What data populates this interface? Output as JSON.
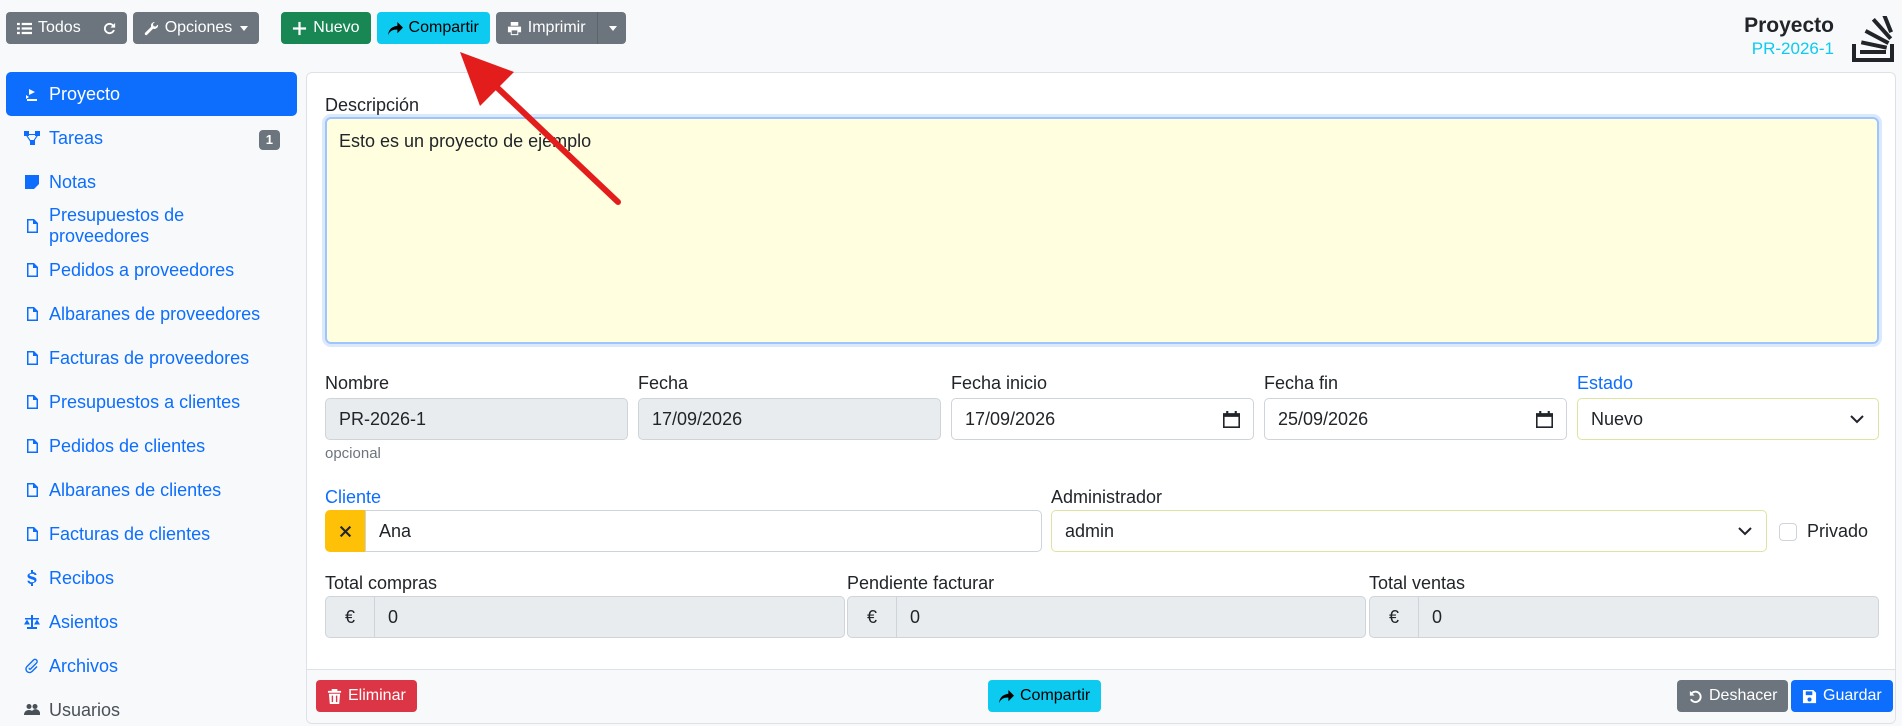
{
  "toolbar": {
    "all_label": "Todos",
    "options_label": "Opciones",
    "new_label": "Nuevo",
    "share_label": "Compartir",
    "print_label": "Imprimir"
  },
  "header": {
    "title": "Proyecto",
    "code": "PR-2026-1"
  },
  "sidebar": {
    "items": [
      {
        "label": "Proyecto",
        "icon": "project-icon"
      },
      {
        "label": "Tareas",
        "icon": "tasks-icon",
        "badge": "1"
      },
      {
        "label": "Notas",
        "icon": "note-icon"
      },
      {
        "label": "Presupuestos de proveedores",
        "icon": "file-icon"
      },
      {
        "label": "Pedidos a proveedores",
        "icon": "file-icon"
      },
      {
        "label": "Albaranes de proveedores",
        "icon": "file-icon"
      },
      {
        "label": "Facturas de proveedores",
        "icon": "file-icon"
      },
      {
        "label": "Presupuestos a clientes",
        "icon": "file-icon"
      },
      {
        "label": "Pedidos de clientes",
        "icon": "file-icon"
      },
      {
        "label": "Albaranes de clientes",
        "icon": "file-icon"
      },
      {
        "label": "Facturas de clientes",
        "icon": "file-icon"
      },
      {
        "label": "Recibos",
        "icon": "dollar-icon"
      },
      {
        "label": "Asientos",
        "icon": "balance-icon"
      },
      {
        "label": "Archivos",
        "icon": "paperclip-icon"
      },
      {
        "label": "Usuarios",
        "icon": "users-icon"
      }
    ]
  },
  "form": {
    "description_label": "Descripción",
    "description_value": "Esto es un proyecto de ejemplo",
    "name_label": "Nombre",
    "name_value": "PR-2026-1",
    "name_help": "opcional",
    "date_label": "Fecha",
    "date_value": "17/09/2026",
    "start_label": "Fecha inicio",
    "start_value": "17/09/2026",
    "end_label": "Fecha fin",
    "end_value": "25/09/2026",
    "status_label": "Estado",
    "status_value": "Nuevo",
    "client_label": "Cliente",
    "client_value": "Ana",
    "admin_label": "Administrador",
    "admin_value": "admin",
    "private_label": "Privado",
    "total_purchases_label": "Total compras",
    "total_purchases_value": "0",
    "pending_invoice_label": "Pendiente facturar",
    "pending_invoice_value": "0",
    "total_sales_label": "Total ventas",
    "total_sales_value": "0",
    "currency_symbol": "€"
  },
  "footer": {
    "delete_label": "Eliminar",
    "share_label": "Compartir",
    "undo_label": "Deshacer",
    "save_label": "Guardar"
  },
  "colors": {
    "primary": "#0d6efd",
    "info": "#0dcaf0",
    "success": "#198754",
    "danger": "#dc3545",
    "secondary": "#6c757d",
    "warning": "#ffc107",
    "annotation_arrow": "#e31c1c"
  }
}
